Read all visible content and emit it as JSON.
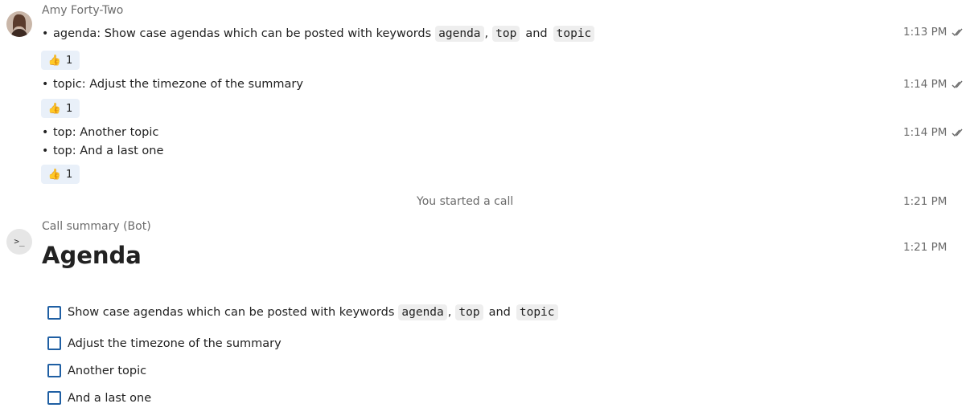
{
  "messages": [
    {
      "author": "Amy Forty-Two",
      "groups": [
        {
          "lines": [
            {
              "prefix": "agenda: Show case agendas which can be posted with keywords",
              "kw1": "agenda",
              "kw2": "top",
              "and": "and",
              "kw3": "topic"
            }
          ],
          "time": "1:13 PM",
          "reaction": {
            "emoji": "👍",
            "count": "1"
          }
        },
        {
          "lines": [
            {
              "text": "topic: Adjust the timezone of the summary"
            }
          ],
          "time": "1:14 PM",
          "reaction": {
            "emoji": "👍",
            "count": "1"
          }
        },
        {
          "lines": [
            {
              "text": "top: Another topic"
            },
            {
              "text": "top: And a last one"
            }
          ],
          "time": "1:14 PM",
          "reaction": {
            "emoji": "👍",
            "count": "1"
          }
        }
      ]
    }
  ],
  "system": {
    "text": "You started a call",
    "time": "1:21 PM"
  },
  "bot": {
    "author": "Call summary (Bot)",
    "avatar_text": ">_",
    "time": "1:21 PM",
    "heading": "Agenda",
    "items": [
      {
        "prefix": "Show case agendas which can be posted with keywords",
        "kw1": "agenda",
        "kw2": "top",
        "and": "and",
        "kw3": "topic"
      },
      {
        "text": "Adjust the timezone of the summary"
      },
      {
        "text": "Another topic"
      },
      {
        "text": "And a last one"
      }
    ]
  },
  "icons": {
    "read_ticks": "double-check-icon",
    "reaction": "thumbs-up-icon",
    "checkbox": "checkbox-unchecked-icon"
  },
  "colors": {
    "reaction_bg": "#e9f0f9",
    "code_bg": "#eeeeee",
    "checkbox_border": "#1f5fa3",
    "muted_text": "#6b6b6b"
  }
}
